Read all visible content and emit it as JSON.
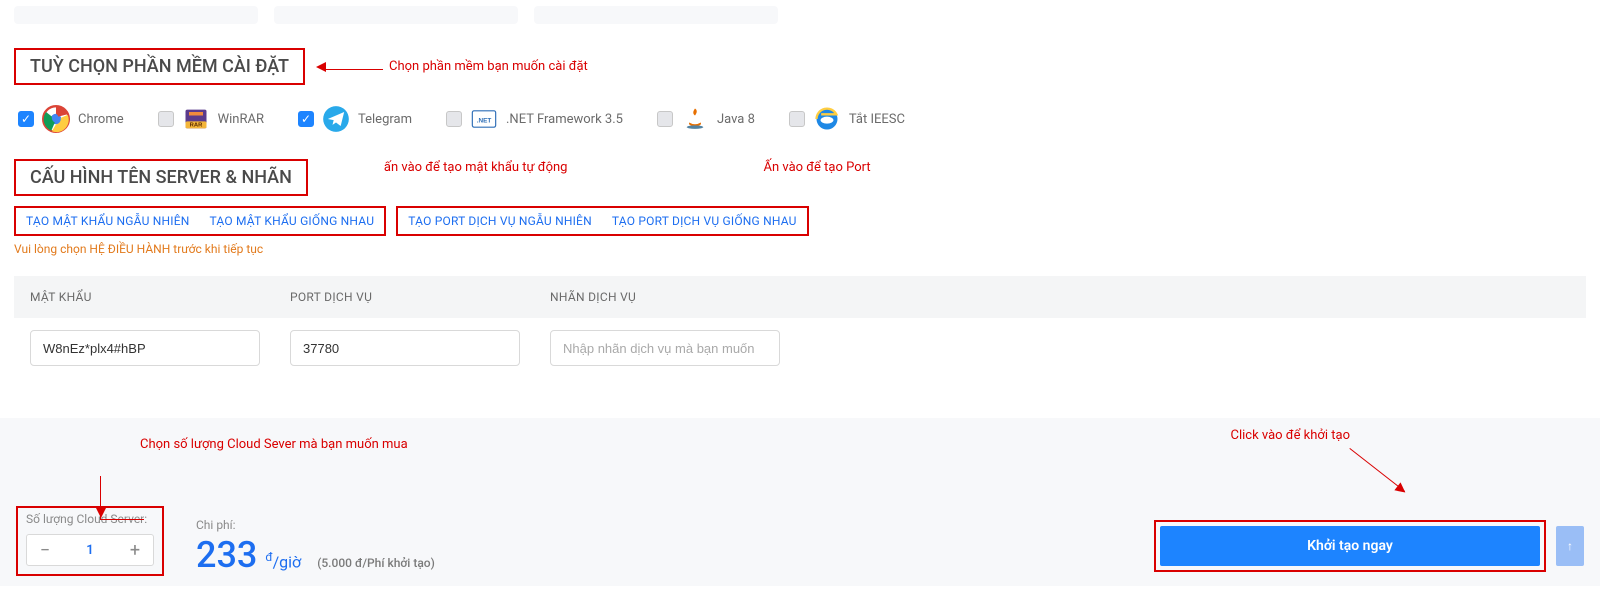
{
  "sections": {
    "software_heading": "TUỲ CHỌN PHẦN MỀM CÀI ĐẶT",
    "server_heading": "CẤU HÌNH TÊN SERVER & NHÃN"
  },
  "annotations": {
    "software": "Chọn phần mềm bạn muốn cài đặt",
    "password": "ấn vào để tạo mật khẩu tự động",
    "port": "Ấn vào để tạo Port",
    "quantity": "Chọn số lượng Cloud Sever mà bạn muốn mua",
    "create": "Click vào để khởi tạo"
  },
  "software": [
    {
      "name": "Chrome",
      "checked": true
    },
    {
      "name": "WinRAR",
      "checked": false
    },
    {
      "name": "Telegram",
      "checked": true
    },
    {
      "name": ".NET Framework 3.5",
      "checked": false
    },
    {
      "name": "Java 8",
      "checked": false
    },
    {
      "name": "Tắt IEESC",
      "checked": false
    }
  ],
  "links": {
    "pw_random": "TẠO MẬT KHẨU NGẪU NHIÊN",
    "pw_same": "TẠO MẬT KHẨU GIỐNG NHAU",
    "port_random": "TẠO PORT DỊCH VỤ NGẪU NHIÊN",
    "port_same": "TẠO PORT DỊCH VỤ GIỐNG NHAU"
  },
  "warning": "Vui lòng chọn HỆ ĐIỀU HÀNH trước khi tiếp tục",
  "columns": {
    "password": "MẬT KHẨU",
    "port": "PORT DỊCH VỤ",
    "label": "NHÃN DỊCH VỤ"
  },
  "inputs": {
    "password_value": "W8nEz*plx4#hBP",
    "port_value": "37780",
    "label_placeholder": "Nhập nhãn dịch vụ mà bạn muốn"
  },
  "footer": {
    "qty_label": "Số lượng Cloud Server:",
    "qty_value": "1",
    "price_label": "Chi phí:",
    "price_value": "233",
    "price_unit_currency": "đ",
    "price_unit_per": "/giờ",
    "price_note": "(5.000 đ/Phí khởi tạo)",
    "create_btn": "Khởi tạo ngay",
    "minus": "−",
    "plus": "+",
    "uparrow": "↑"
  }
}
